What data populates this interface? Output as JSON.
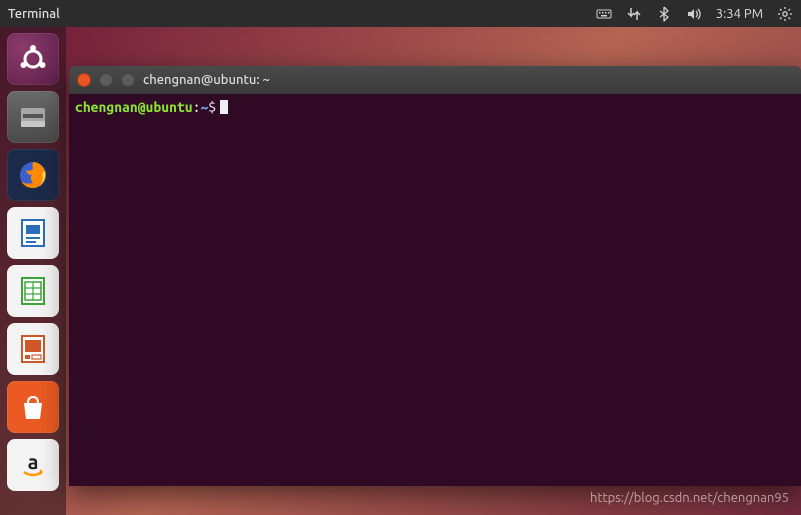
{
  "top_bar": {
    "title": "Terminal",
    "time": "3:34 PM"
  },
  "launcher": {
    "items": [
      {
        "name": "ubuntu-dash"
      },
      {
        "name": "files"
      },
      {
        "name": "firefox"
      },
      {
        "name": "libreoffice-writer"
      },
      {
        "name": "libreoffice-calc"
      },
      {
        "name": "libreoffice-impress"
      },
      {
        "name": "ubuntu-software"
      },
      {
        "name": "amazon"
      }
    ]
  },
  "terminal": {
    "window_title": "chengnan@ubuntu: ~",
    "prompt": {
      "user_host": "chengnan@ubuntu",
      "separator": ":",
      "path": "~",
      "symbol": "$"
    },
    "input": ""
  },
  "watermark": "https://blog.csdn.net/chengnan95"
}
